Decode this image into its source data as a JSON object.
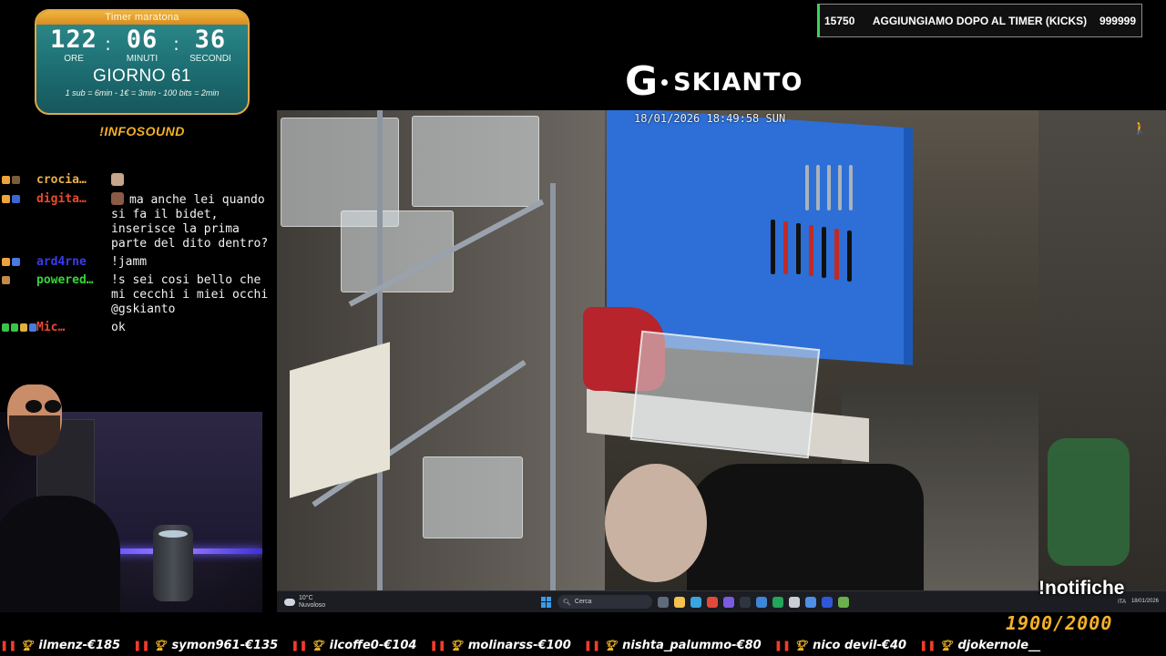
{
  "timer": {
    "title": "Timer maratona",
    "hours": "122",
    "hours_label": "ORE",
    "minutes": "06",
    "minutes_label": "MINUTI",
    "seconds": "36",
    "seconds_label": "SECONDI",
    "separator": ":",
    "day": "GIORNO 61",
    "rates": "1 sub = 6min - 1€ = 3min - 100 bits = 2min"
  },
  "infosound": "!INFOSOUND",
  "chat": {
    "messages": [
      {
        "user": "crocia…",
        "user_color": "#e9b04a",
        "text": ""
      },
      {
        "user": "digita…",
        "user_color": "#e8492f",
        "text": "ma anche lei quando si fa il bidet, inserisce la prima parte del dito dentro?"
      },
      {
        "user": "ard4rne",
        "user_color": "#3a3bf0",
        "text": "!jamm"
      },
      {
        "user": "powered…",
        "user_color": "#37d43a",
        "text": "!s sei cosi bello che mi cecchi i miei occhi @gskianto"
      },
      {
        "user": "Mic…",
        "user_color": "#e8492f",
        "text": "ok"
      }
    ]
  },
  "goal": {
    "left_value": "15750",
    "label": "AGGIUNGIAMO DOPO AL TIMER (KICKS)",
    "right_value": "999999"
  },
  "logo": {
    "letter": "G",
    "name": "SKIANTO"
  },
  "camera": {
    "timestamp": "18/01/2026 18:49:58 SUN"
  },
  "taskbar": {
    "weather_temp": "10°C",
    "weather_desc": "Nuvoloso",
    "search_label": "Cerca",
    "lang": "ITA",
    "clock_date": "18/01/2026"
  },
  "notifiche": "!notifiche",
  "counter": "1900/2000",
  "ticker": [
    {
      "name": "ilmenz",
      "amount": "€185"
    },
    {
      "name": "symon961",
      "amount": "€135"
    },
    {
      "name": "ilcoffe0",
      "amount": "€104"
    },
    {
      "name": "molinarss",
      "amount": "€100"
    },
    {
      "name": "nishta_palummo",
      "amount": "€80"
    },
    {
      "name": "nico devil",
      "amount": "€40"
    },
    {
      "name": "djokernole__",
      "amount": ""
    }
  ],
  "colors": {
    "accent_orange": "#f3b128",
    "timer_teal": "#1d6f73",
    "pegboard_blue": "#2d6fd6",
    "goal_green": "#3ad15a"
  }
}
